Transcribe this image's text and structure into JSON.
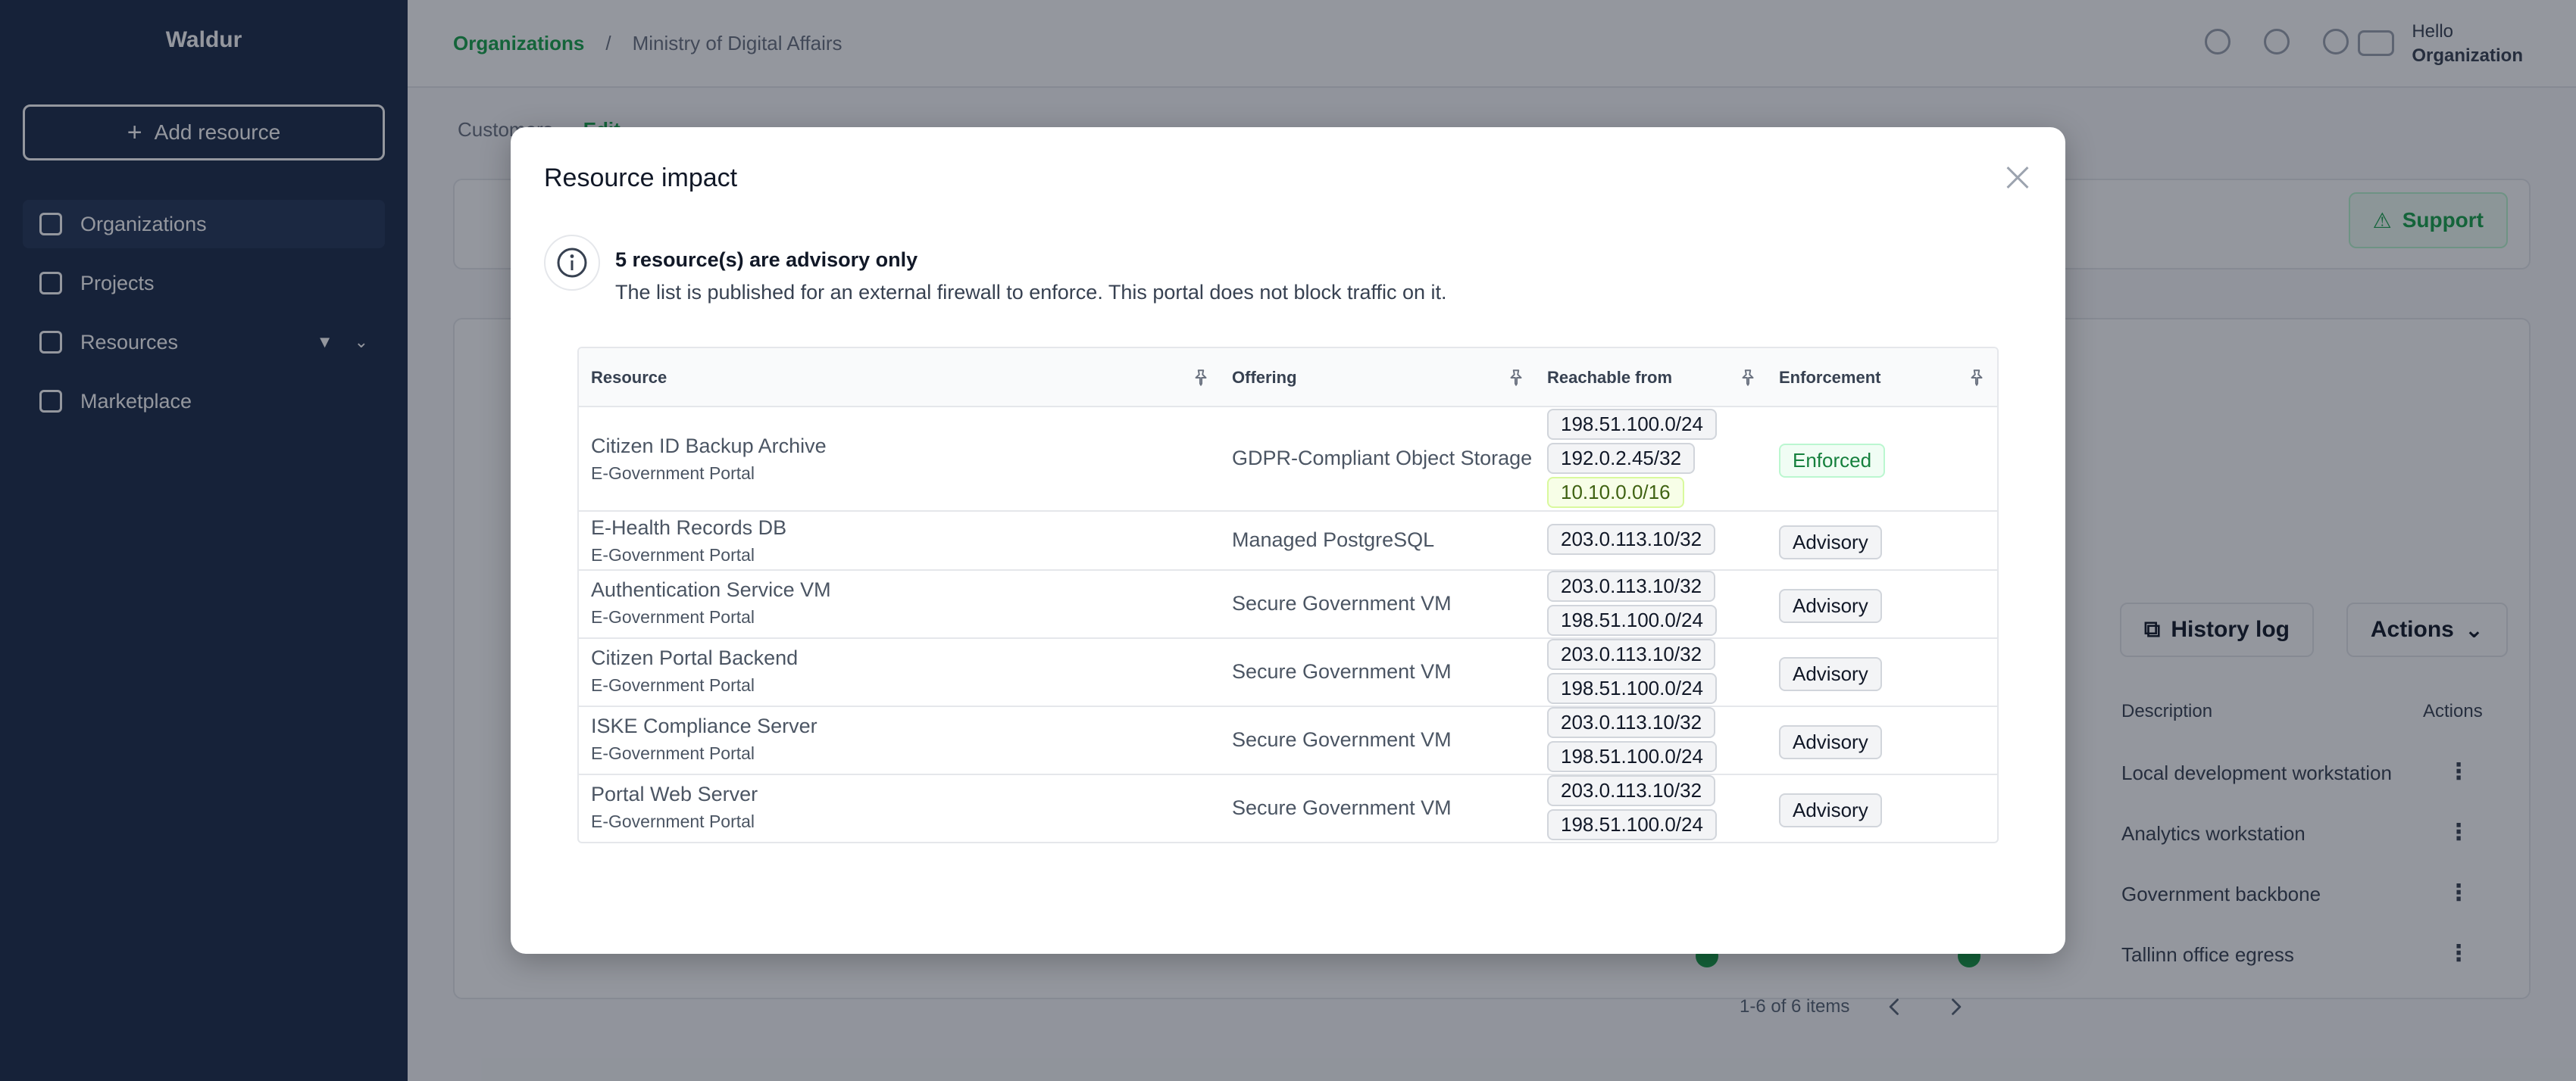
{
  "app": {
    "logo": "Waldur",
    "add_resource": "Add resource",
    "nav": [
      {
        "label": "Organizations"
      },
      {
        "label": "Projects"
      },
      {
        "label": "Resources"
      },
      {
        "label": "Marketplace"
      }
    ],
    "breadcrumb": [
      "Organizations",
      "/",
      "Ministry of Digital Affairs"
    ],
    "user": {
      "greeting": "Hello",
      "name": "Organization"
    },
    "tabs": [
      "Customers",
      "Edit"
    ],
    "support_button": "Support",
    "history_log_button": "History log",
    "actions_button": "Actions",
    "bg_columns": [
      "Description",
      "Actions"
    ],
    "bg_descriptions": [
      "Local development workstation",
      "Analytics workstation",
      "Government backbone",
      "Tallinn office egress"
    ]
  },
  "modal": {
    "title": "Resource impact",
    "notice": {
      "title": "5 resource(s) are advisory only",
      "text": "The list is published for an external firewall to enforce. This portal does not block traffic on it."
    },
    "columns": {
      "resource": "Resource",
      "offering": "Offering",
      "reachable_from": "Reachable from",
      "enforcement": "Enforcement"
    },
    "rows": [
      {
        "name": "Citizen ID Backup Archive",
        "project": "E-Government Portal",
        "offering": "GDPR-Compliant Object Storage",
        "reachable": [
          "198.51.100.0/24",
          "192.0.2.45/32",
          "10.10.0.0/16"
        ],
        "enforcement": "Enforced"
      },
      {
        "name": "E-Health Records DB",
        "project": "E-Government Portal",
        "offering": "Managed PostgreSQL",
        "reachable": [
          "203.0.113.10/32"
        ],
        "enforcement": "Advisory"
      },
      {
        "name": "Authentication Service VM",
        "project": "E-Government Portal",
        "offering": "Secure Government VM",
        "reachable": [
          "203.0.113.10/32",
          "198.51.100.0/24"
        ],
        "enforcement": "Advisory"
      },
      {
        "name": "Citizen Portal Backend",
        "project": "E-Government Portal",
        "offering": "Secure Government VM",
        "reachable": [
          "203.0.113.10/32",
          "198.51.100.0/24"
        ],
        "enforcement": "Advisory"
      },
      {
        "name": "ISKE Compliance Server",
        "project": "E-Government Portal",
        "offering": "Secure Government VM",
        "reachable": [
          "203.0.113.10/32",
          "198.51.100.0/24"
        ],
        "enforcement": "Advisory"
      },
      {
        "name": "Portal Web Server",
        "project": "E-Government Portal",
        "offering": "Secure Government VM",
        "reachable": [
          "203.0.113.10/32",
          "198.51.100.0/24"
        ],
        "enforcement": "Advisory"
      }
    ],
    "pagination": {
      "text": "1-6 of 6 items"
    }
  }
}
